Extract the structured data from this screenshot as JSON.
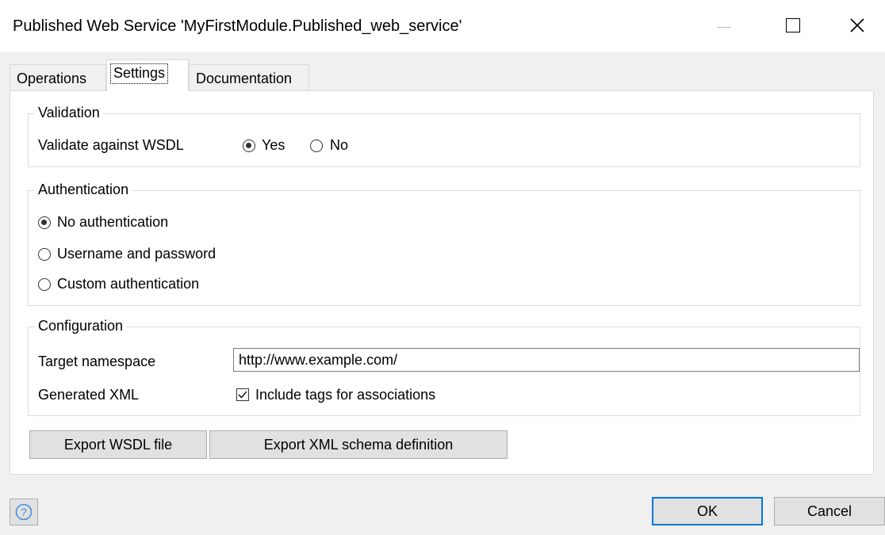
{
  "window": {
    "title": "Published Web Service 'MyFirstModule.Published_web_service'"
  },
  "tabs": [
    {
      "label": "Operations",
      "active": false
    },
    {
      "label": "Settings",
      "active": true
    },
    {
      "label": "Documentation",
      "active": false
    }
  ],
  "validation": {
    "legend": "Validation",
    "label": "Validate against WSDL",
    "options": [
      {
        "label": "Yes",
        "checked": true
      },
      {
        "label": "No",
        "checked": false
      }
    ]
  },
  "authentication": {
    "legend": "Authentication",
    "options": [
      {
        "label": "No authentication",
        "checked": true
      },
      {
        "label": "Username and password",
        "checked": false
      },
      {
        "label": "Custom authentication",
        "checked": false
      }
    ]
  },
  "configuration": {
    "legend": "Configuration",
    "namespace_label": "Target namespace",
    "namespace_value": "http://www.example.com/",
    "xml_label": "Generated XML",
    "include_tags_label": "Include tags for associations",
    "include_tags_checked": true
  },
  "buttons": {
    "export_wsdl": "Export WSDL file",
    "export_xsd": "Export XML schema definition",
    "ok": "OK",
    "cancel": "Cancel"
  },
  "icons": {
    "help": "help-icon",
    "minimize": "minimize-icon",
    "maximize": "maximize-icon",
    "close": "close-icon",
    "radio_selected": "radio-selected-icon",
    "checkbox_checked": "checkmark-icon"
  },
  "colors": {
    "accent": "#0078d7",
    "dialog_background": "#f0f0f0"
  }
}
